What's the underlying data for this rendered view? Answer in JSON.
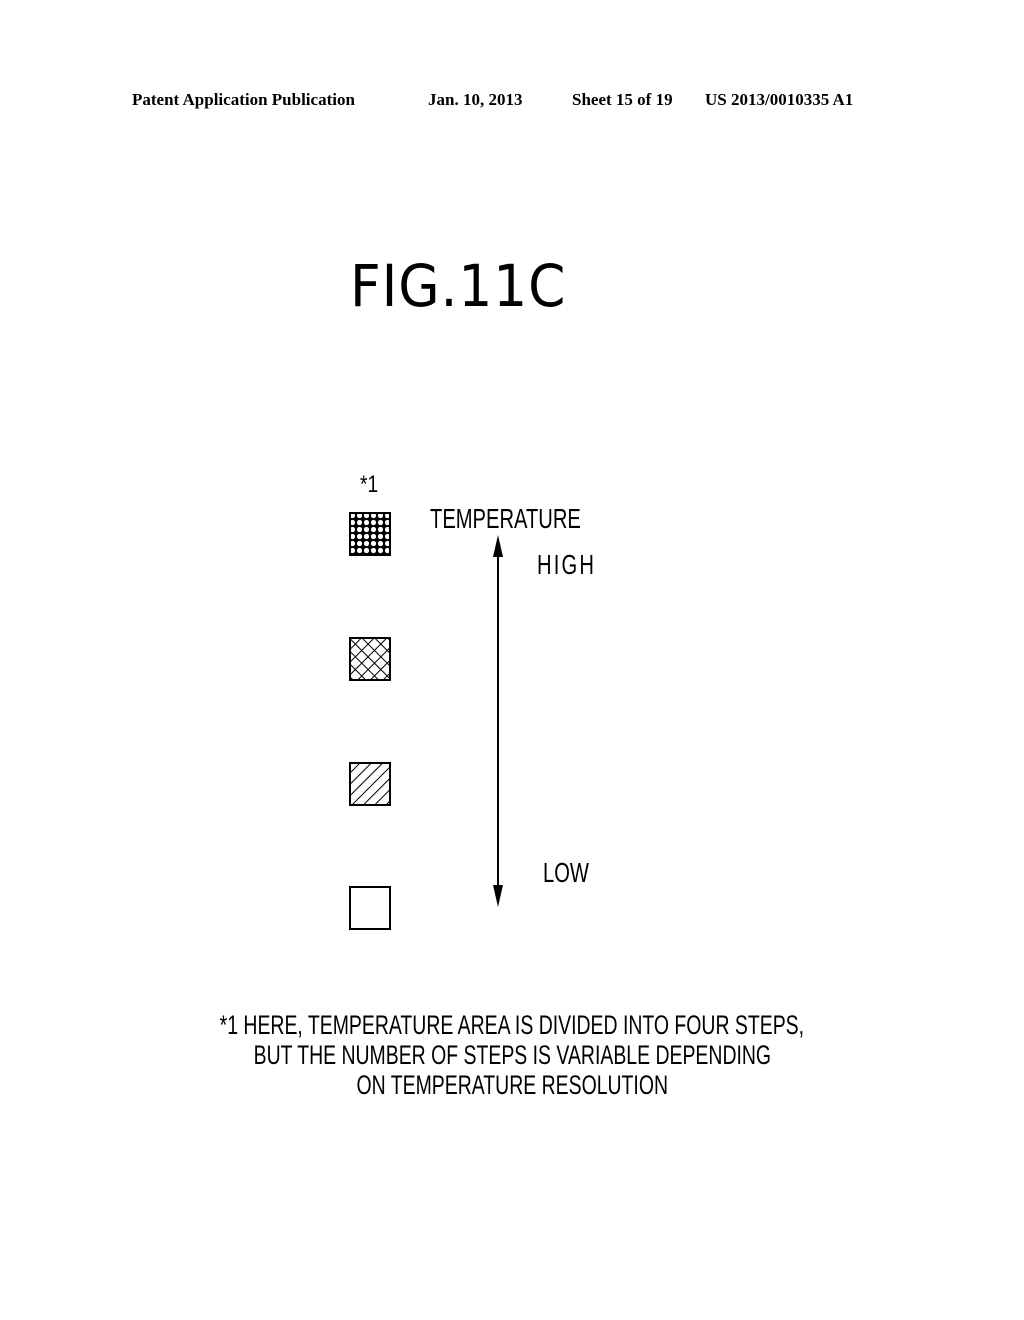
{
  "header": {
    "publication": "Patent Application Publication",
    "date": "Jan. 10, 2013",
    "sheet": "Sheet 15 of 19",
    "number": "US 2013/0010335 A1"
  },
  "figure": {
    "title": "FIG.11C",
    "note_marker": "*1",
    "axis_label": "TEMPERATURE",
    "high_label": "HIGH",
    "low_label": "LOW",
    "legend_swatches": [
      {
        "pattern": "honeycomb-dots",
        "level": "highest"
      },
      {
        "pattern": "cross-hatch",
        "level": "high-mid"
      },
      {
        "pattern": "diagonal-hatch",
        "level": "low-mid"
      },
      {
        "pattern": "blank",
        "level": "lowest"
      }
    ],
    "arrow_icon": "double-headed-vertical-arrow"
  },
  "footnote": {
    "lines": [
      "*1 HERE, TEMPERATURE AREA IS DIVIDED INTO FOUR STEPS,",
      "BUT THE NUMBER OF STEPS IS VARIABLE DEPENDING",
      "ON TEMPERATURE RESOLUTION"
    ]
  }
}
